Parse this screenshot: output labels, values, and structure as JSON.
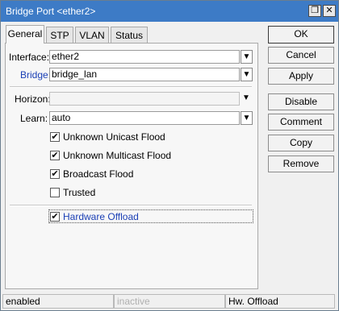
{
  "window": {
    "title": "Bridge Port <ether2>",
    "restore_glyph": "❐",
    "close_glyph": "✕"
  },
  "tabs": [
    "General",
    "STP",
    "VLAN",
    "Status"
  ],
  "form": {
    "interface": {
      "label": "Interface:",
      "value": "ether2"
    },
    "bridge": {
      "label": "Bridge:",
      "value": "bridge_lan"
    },
    "horizon": {
      "label": "Horizon:",
      "value": ""
    },
    "learn": {
      "label": "Learn:",
      "value": "auto"
    },
    "dropdown_glyph": "▼",
    "checkboxes": [
      {
        "label": "Unknown Unicast Flood",
        "checked": true
      },
      {
        "label": "Unknown Multicast Flood",
        "checked": true
      },
      {
        "label": "Broadcast Flood",
        "checked": true
      },
      {
        "label": "Trusted",
        "checked": false
      }
    ],
    "hardware_offload": {
      "label": "Hardware Offload",
      "checked": true
    },
    "check_glyph": "✔"
  },
  "buttons": [
    "OK",
    "Cancel",
    "Apply",
    "Disable",
    "Comment",
    "Copy",
    "Remove"
  ],
  "status": {
    "state": "enabled",
    "active": "inactive",
    "hw": "Hw. Offload"
  },
  "colors": {
    "titlebar": "#3d7bc6",
    "bridge_label": "#1a3fb5",
    "offload_text": "#1a3fb5",
    "inactive_text": "#b0b0b0"
  }
}
